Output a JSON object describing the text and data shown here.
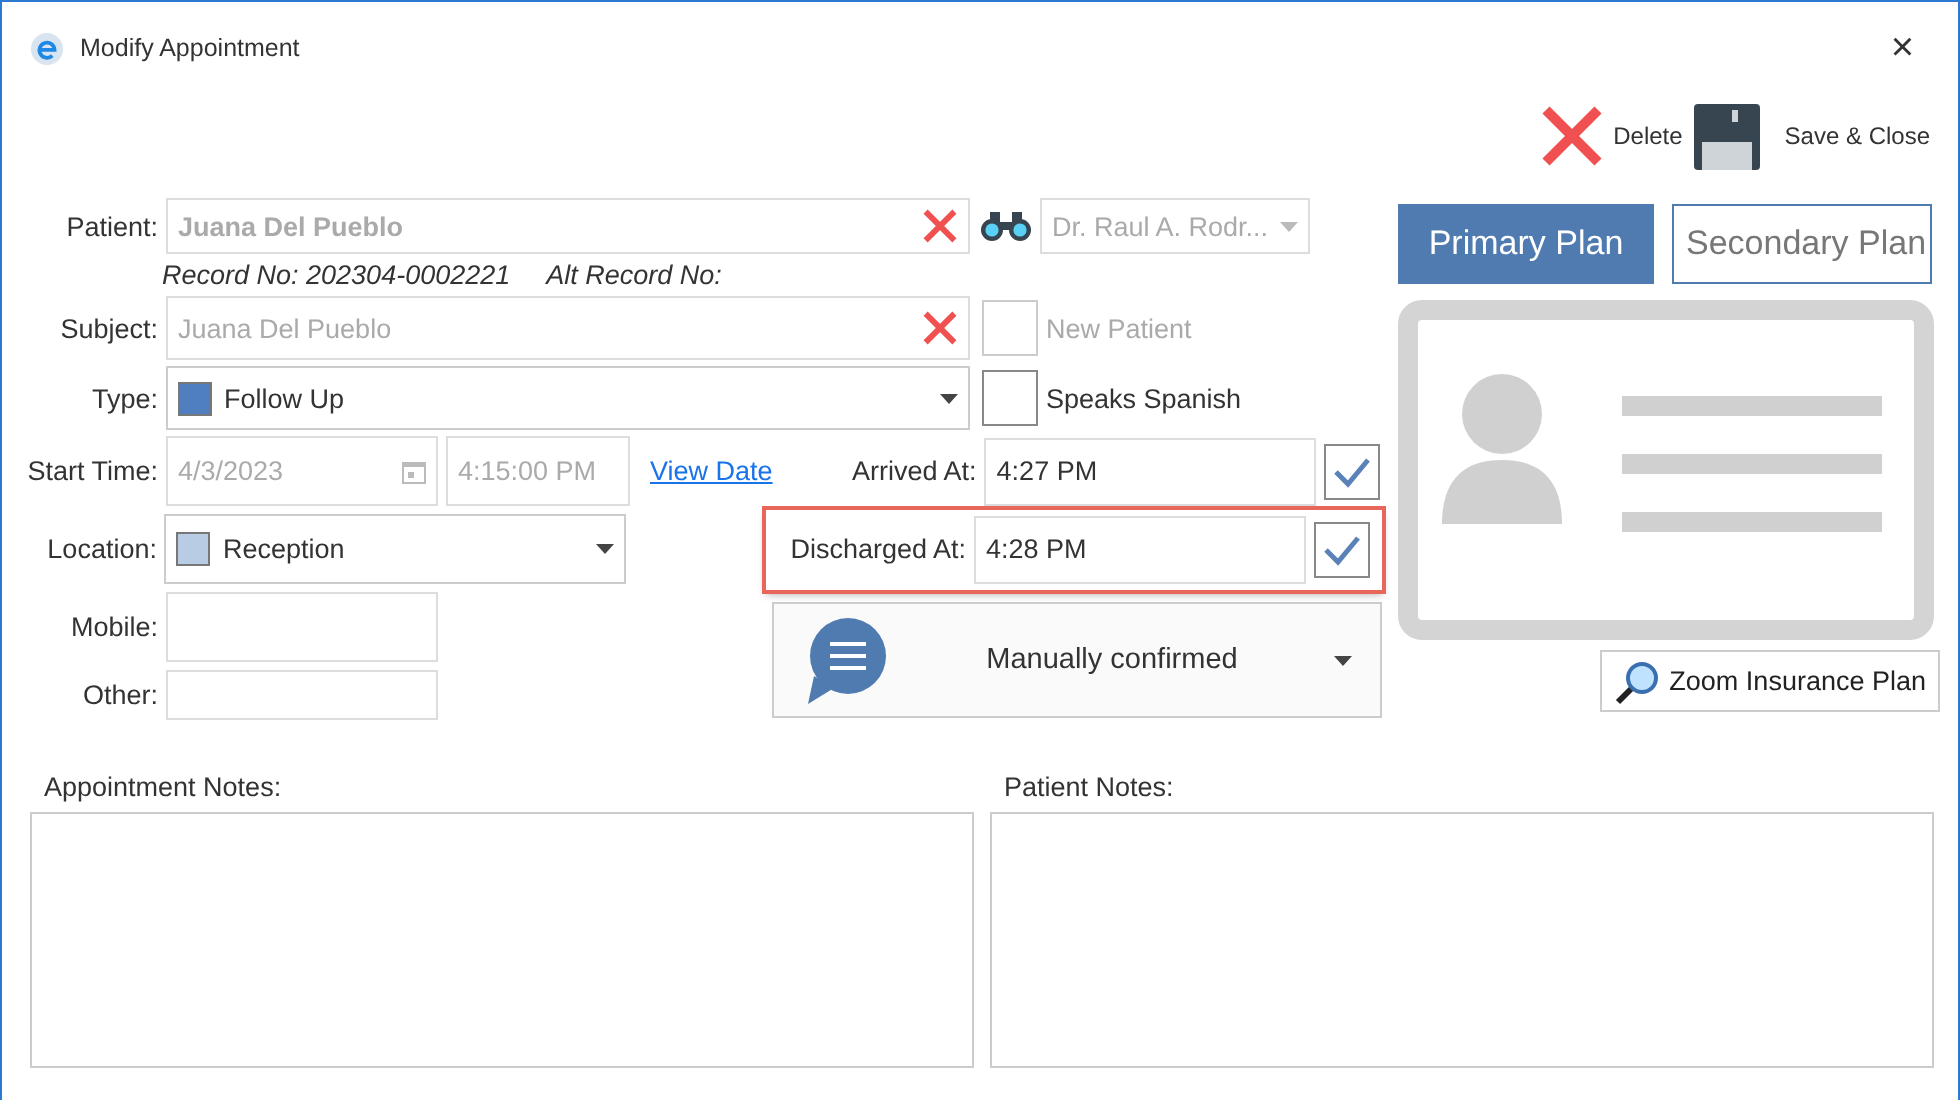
{
  "window": {
    "title": "Modify Appointment",
    "close": "×"
  },
  "toolbar": [
    {
      "kind": "delete",
      "label": "Delete"
    },
    {
      "kind": "save",
      "label": "Save & Close"
    }
  ],
  "patient": {
    "label": "Patient:",
    "value": "Juana Del Pueblo",
    "doctor": "Dr. Raul A. Rodr...",
    "record_no": "Record No: 202304-0002221",
    "alt_record_no": "Alt Record No:"
  },
  "subject": {
    "label": "Subject:",
    "value": "Juana Del Pueblo"
  },
  "checkboxes": [
    {
      "label": "New Patient",
      "checked": false,
      "disabled": true
    },
    {
      "label": "Speaks Spanish",
      "checked": false,
      "disabled": false
    }
  ],
  "type": {
    "label": "Type:",
    "value": "Follow Up",
    "color": "#4f7fbf"
  },
  "start_time": {
    "label": "Start Time:",
    "date": "4/3/2023",
    "time": "4:15:00 PM",
    "link": "View Date"
  },
  "times": [
    {
      "label": "Arrived At:",
      "value": "4:27 PM",
      "checked": true,
      "highlighted": false
    },
    {
      "label": "Discharged At:",
      "value": "4:28 PM",
      "checked": true,
      "highlighted": true
    }
  ],
  "location": {
    "label": "Location:",
    "value": "Reception",
    "color": "#b8cce4"
  },
  "mobile": {
    "label": "Mobile:"
  },
  "other": {
    "label": "Other:"
  },
  "confirmation": {
    "value": "Manually confirmed"
  },
  "plans": {
    "tabs": [
      {
        "label": "Primary Plan",
        "selected": true
      },
      {
        "label": "Secondary Plan",
        "selected": false
      }
    ],
    "zoom_button": "Zoom Insurance Plan"
  },
  "notes": [
    {
      "label": "Appointment Notes:"
    },
    {
      "label": "Patient Notes:"
    }
  ]
}
